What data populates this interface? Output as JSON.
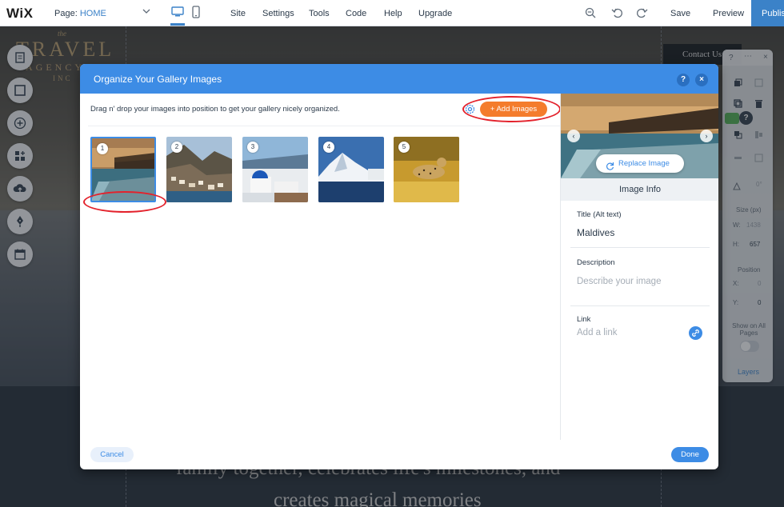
{
  "topbar": {
    "logo": "WiX",
    "page_label": "Page:",
    "page_name": "HOME",
    "menu": [
      "Site",
      "Settings",
      "Tools",
      "Code",
      "Help",
      "Upgrade"
    ],
    "save": "Save",
    "preview": "Preview",
    "publish": "Publish"
  },
  "site": {
    "brand_the": "the",
    "brand_title": "TRAVEL",
    "brand_agency": "AGENCY",
    "brand_inc": "INC",
    "contact": "Contact Us",
    "hero_line1": "family together, celebrates life's milestones, and",
    "hero_line2": "creates magical memories"
  },
  "inspector": {
    "help": "?",
    "close": "×",
    "size_label": "Size (px)",
    "w_label": "W:",
    "w_value": "1438",
    "h_label": "H:",
    "h_value": "657",
    "angle_value": "0°",
    "position_label": "Position",
    "x_label": "X:",
    "x_value": "0",
    "y_label": "Y:",
    "y_value": "0",
    "show_all_pages": "Show on All Pages",
    "layers": "Layers"
  },
  "modal": {
    "title": "Organize Your Gallery Images",
    "help": "?",
    "close": "×",
    "instructions": "Drag n' drop your images into position to get your gallery nicely organized.",
    "add_images": "+ Add Images",
    "thumbnails": [
      {
        "number": "1",
        "subject": "maldives-overwater-villas"
      },
      {
        "number": "2",
        "subject": "coastal-cliff-town"
      },
      {
        "number": "3",
        "subject": "santorini-blue-domes"
      },
      {
        "number": "4",
        "subject": "snowy-mountain-sea"
      },
      {
        "number": "5",
        "subject": "cheetah-savanna"
      }
    ],
    "replace_image": "Replace Image",
    "image_info": "Image Info",
    "title_label": "Title (Alt text)",
    "title_value": "Maldives",
    "description_label": "Description",
    "description_placeholder": "Describe your image",
    "link_label": "Link",
    "link_placeholder": "Add a link",
    "cancel": "Cancel",
    "done": "Done"
  },
  "colors": {
    "accent": "#3d8ce5",
    "add_button": "#f47c2c",
    "highlight": "#e3222c"
  }
}
